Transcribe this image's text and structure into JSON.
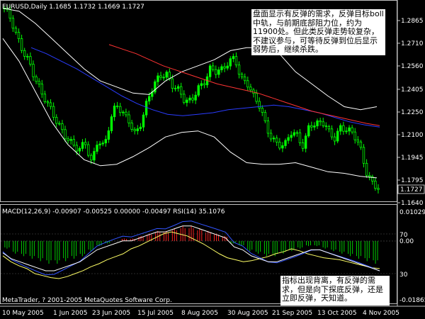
{
  "main_title": "EURUSD,Daily  1.1685 1.1732 1.1669 1.1727",
  "price_tags": [
    "1.2865",
    "1.2710",
    "1.2560",
    "1.2405",
    "1.2250",
    "1.2100",
    "1.1945",
    "1.1795",
    "1.1640"
  ],
  "current_price": "1.1727",
  "sub_title": "MACD(12,26,9) -0.00907 -0.00525 0.00000 -0.00497  RSI(14) 35.1076",
  "sub_tags": {
    "macd_top": "0.01029",
    "rsi_70": "70",
    "zero": "0.00",
    "rsi_30": "30",
    "macd_bottom": "-0.01865"
  },
  "copyright": "MetaTrader, ? 2001-2005 MetaQuotes Software Corp.",
  "date_labels": [
    "10 May 2005",
    "1 Jun 2005",
    "23 Jun 2005",
    "15 Jul 2005",
    "8 Aug 2005",
    "30 Aug 2005",
    "21 Sep 2005",
    "13 Oct 2005",
    "4 Nov 2005"
  ],
  "annotations": {
    "top": "盘面显示有反弹的需求，反弹目标boll中轨，与前期底部阻力位，约为11900处。但此类反弹走势较复杂，不建议参与，可等待反弹到位后显示弱势后，继续杀跌。",
    "bottom": "指标出现背离，有反弹的需求，但是向下探底反弹，还是立即反弹，天知道。"
  },
  "colors": {
    "background": "#000000",
    "candle": "#00ff00",
    "bollinger": "#ffffff",
    "ma_red": "#ff3333",
    "ma_blue": "#2a3cff",
    "macd_up": "#ff2020",
    "macd_down": "#00cc00",
    "signal": "#ffff66",
    "rsi": "#ffffff",
    "macd_line": "#3355ff"
  },
  "chart_data": [
    {
      "type": "candlestick",
      "symbol": "EURUSD",
      "timeframe": "Daily",
      "ohlc_last": {
        "open": 1.1685,
        "high": 1.1732,
        "low": 1.1669,
        "close": 1.1727
      },
      "ylim": [
        1.1625,
        1.2945
      ],
      "x_dates": [
        "10 May 2005",
        "1 Jun 2005",
        "23 Jun 2005",
        "15 Jul 2005",
        "8 Aug 2005",
        "30 Aug 2005",
        "21 Sep 2005",
        "13 Oct 2005",
        "4 Nov 2005"
      ],
      "close_path": [
        1.29,
        1.282,
        1.27,
        1.262,
        1.256,
        1.244,
        1.233,
        1.225,
        1.218,
        1.212,
        1.206,
        1.2,
        1.195,
        1.2,
        1.188,
        1.205,
        1.199,
        1.215,
        1.225,
        1.22,
        1.217,
        1.208,
        1.215,
        1.228,
        1.238,
        1.246,
        1.248,
        1.24,
        1.235,
        1.227,
        1.228,
        1.238,
        1.242,
        1.25,
        1.247,
        1.248,
        1.255,
        1.259,
        1.244,
        1.24,
        1.23,
        1.225,
        1.213,
        1.205,
        1.2,
        1.198,
        1.207,
        1.206,
        1.2,
        1.215,
        1.212,
        1.214,
        1.208,
        1.205,
        1.213,
        1.21,
        1.206,
        1.198,
        1.183,
        1.176,
        1.1727
      ],
      "bollinger_upper": [
        1.29,
        1.288,
        1.28,
        1.27,
        1.26,
        1.25,
        1.242,
        1.238,
        1.234,
        1.233,
        1.242,
        1.248,
        1.252,
        1.256,
        1.262,
        1.264,
        1.264,
        1.26,
        1.248,
        1.24,
        1.232,
        1.225,
        1.223,
        1.225
      ],
      "bollinger_lower": [
        1.27,
        1.255,
        1.235,
        1.215,
        1.2,
        1.19,
        1.186,
        1.187,
        1.192,
        1.198,
        1.205,
        1.208,
        1.209,
        1.205,
        1.195,
        1.188,
        1.187,
        1.187,
        1.188,
        1.185,
        1.182,
        1.181,
        1.179,
        1.178
      ],
      "ma_blue": [
        1.264,
        1.26,
        1.255,
        1.25,
        1.244,
        1.238,
        1.232,
        1.227,
        1.223,
        1.22,
        1.219,
        1.22,
        1.221,
        1.223,
        1.224,
        1.225,
        1.226,
        1.225,
        1.223,
        1.221,
        1.218,
        1.215,
        1.213,
        1.2115
      ],
      "ma_red": [
        1.266,
        1.263,
        1.26,
        1.256,
        1.252,
        1.249,
        1.246,
        1.243,
        1.24,
        1.238,
        1.236,
        1.234,
        1.231,
        1.228,
        1.225,
        1.222,
        1.22,
        1.218,
        1.216,
        1.214,
        1.2125
      ]
    },
    {
      "type": "bar",
      "name": "MACD(12,26,9)",
      "values_last": {
        "macd": -0.00907,
        "signal": -0.00525,
        "zero": 0.0,
        "hist": -0.00497
      },
      "ylim": [
        -0.01865,
        0.01029
      ],
      "histogram": [
        -0.003,
        -0.005,
        -0.006,
        -0.007,
        -0.008,
        -0.009,
        -0.009,
        -0.008,
        -0.007,
        -0.006,
        -0.004,
        -0.002,
        -0.001,
        0.0,
        0.001,
        0.001,
        0.002,
        0.003,
        0.004,
        0.004,
        0.005,
        0.006,
        0.006,
        0.005,
        0.004,
        0.003,
        0.002,
        -0.001,
        -0.002,
        -0.004,
        -0.005,
        -0.006,
        -0.006,
        -0.005,
        -0.004,
        -0.003,
        -0.002,
        -0.002,
        -0.003,
        -0.004,
        -0.005,
        -0.006,
        -0.007,
        -0.008,
        -0.009
      ]
    },
    {
      "type": "line",
      "name": "RSI(14)",
      "value_last": 35.1076,
      "levels": [
        30,
        70
      ],
      "values": [
        48,
        42,
        38,
        35,
        30,
        28,
        26,
        25,
        27,
        30,
        33,
        37,
        40,
        44,
        47,
        50,
        55,
        58,
        62,
        66,
        70,
        72,
        70,
        68,
        64,
        60,
        55,
        50,
        46,
        44,
        42,
        43,
        45,
        47,
        50,
        52,
        55,
        53,
        50,
        48,
        46,
        45,
        44,
        42,
        40,
        38,
        36,
        35.1
      ]
    }
  ]
}
